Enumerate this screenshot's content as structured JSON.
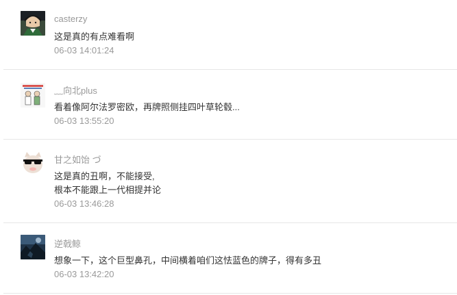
{
  "comments": [
    {
      "username": "casterzy",
      "lines": [
        "这是真的有点难看啊"
      ],
      "time": "06-03 14:01:24",
      "avatar": "avatar-anime-character-icon"
    },
    {
      "username": "﹏向北plus",
      "lines": [
        "看着像阿尔法罗密欧，再牌照侧挂四叶草轮毂..."
      ],
      "time": "06-03 13:55:20",
      "avatar": "avatar-comic-figures-icon"
    },
    {
      "username": "甘之如饴 づ",
      "lines": [
        "这是真的丑啊，不能接受,",
        "根本不能跟上一代相提并论"
      ],
      "time": "06-03 13:46:28",
      "avatar": "avatar-cat-sunglasses-icon"
    },
    {
      "username": "逆戟鲸",
      "lines": [
        "想象一下，这个巨型鼻孔，中间横着咱们这怯蓝色的牌子，得有多丑"
      ],
      "time": "06-03 13:42:20",
      "avatar": "avatar-dark-landscape-icon"
    }
  ],
  "colors": {
    "username": "#999999",
    "text": "#333333",
    "time": "#999999",
    "divider": "#e6e6e6"
  }
}
